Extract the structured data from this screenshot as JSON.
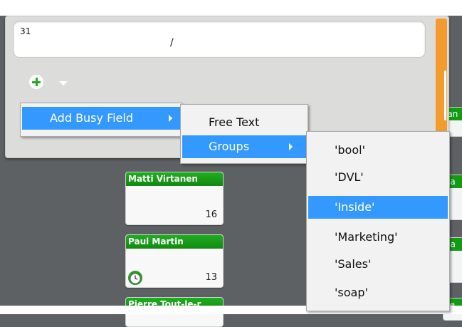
{
  "editor": {
    "value": "31",
    "slash": "/"
  },
  "menu": {
    "root": {
      "label": "Add Busy Field"
    },
    "submenu": [
      {
        "label": "Free Text"
      },
      {
        "label": "Groups"
      }
    ],
    "groups": [
      {
        "label": "'bool'"
      },
      {
        "label": "'DVL'"
      },
      {
        "label": "'Inside'"
      },
      {
        "label": "'Marketing'"
      },
      {
        "label": "'Sales'"
      },
      {
        "label": "'soap'"
      }
    ],
    "selected_group": "'Inside'",
    "highlight_color": "#3399ff"
  },
  "people": [
    {
      "name": "Matti Virtanen",
      "count": "16"
    },
    {
      "name": "Paul Martin",
      "count": "13"
    },
    {
      "name": "Pierre Tout-le-r",
      "count": ""
    }
  ],
  "partial_cards": [
    {
      "label": "lan"
    },
    {
      "label": "ea"
    },
    {
      "label": "ua"
    },
    {
      "label": "lie"
    }
  ],
  "colors": {
    "accent_orange": "#f39c2d",
    "header_green": "#149a14",
    "background": "#5d6163"
  },
  "icons": {
    "add": "plus-circle-icon",
    "dropdown": "chevron-down-icon",
    "submenu": "chevron-right-icon",
    "clock": "clock-icon"
  }
}
